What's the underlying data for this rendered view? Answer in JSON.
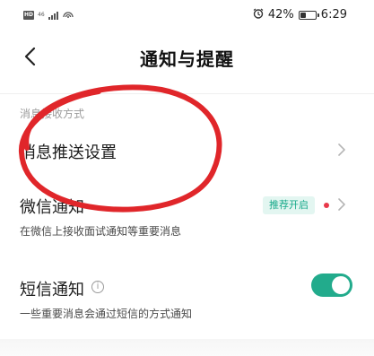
{
  "status_bar": {
    "hd": "HD",
    "network_top": "46",
    "network_bottom": "ll",
    "hotspot": "⦾²",
    "battery_text": "42%",
    "battery_level": 0.42,
    "time": "6:29",
    "icons": [
      "alarm-icon",
      "battery-icon",
      "signal-icon",
      "hotspot-icon"
    ]
  },
  "header": {
    "title": "通知与提醒",
    "back_icon": "chevron-left-icon"
  },
  "section": {
    "label": "消息接收方式"
  },
  "items": {
    "push": {
      "title": "消息推送设置"
    },
    "wechat": {
      "title": "微信通知",
      "badge": "推荐开启",
      "subtitle": "在微信上接收面试通知等重要消息"
    },
    "sms": {
      "title": "短信通知",
      "subtitle": "一些重要消息会通过短信的方式通知",
      "enabled": true
    }
  },
  "colors": {
    "accent": "#22ab8c",
    "badge_bg": "#e3f6f1",
    "badge_text": "#18a98a",
    "dot": "#e8394a",
    "annotation": "#e0262a"
  }
}
